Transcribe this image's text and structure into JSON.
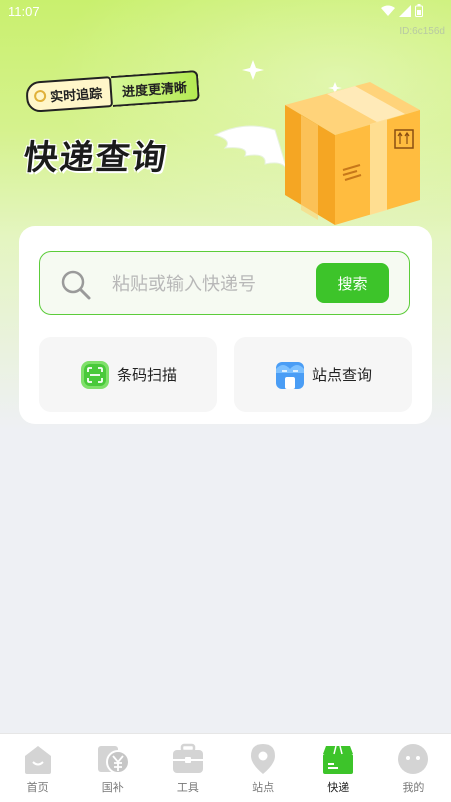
{
  "status_bar": {
    "time": "11:07"
  },
  "device_id": "ID:6c156d",
  "banner": {
    "tag_realtime": "实时追踪",
    "tag_progress": "进度更清晰",
    "title": "快递查询"
  },
  "search": {
    "placeholder": "粘贴或输入快递号",
    "button_label": "搜索"
  },
  "actions": {
    "scan_label": "条码扫描",
    "station_label": "站点查询"
  },
  "nav": {
    "items": [
      {
        "label": "首页",
        "icon": "home-icon"
      },
      {
        "label": "国补",
        "icon": "subsidy-icon"
      },
      {
        "label": "工具",
        "icon": "toolbox-icon"
      },
      {
        "label": "站点",
        "icon": "location-icon"
      },
      {
        "label": "快递",
        "icon": "package-icon",
        "active": true
      },
      {
        "label": "我的",
        "icon": "profile-icon"
      }
    ]
  },
  "colors": {
    "accent": "#3dc42a",
    "inactive_icon": "#d4d4d4"
  }
}
